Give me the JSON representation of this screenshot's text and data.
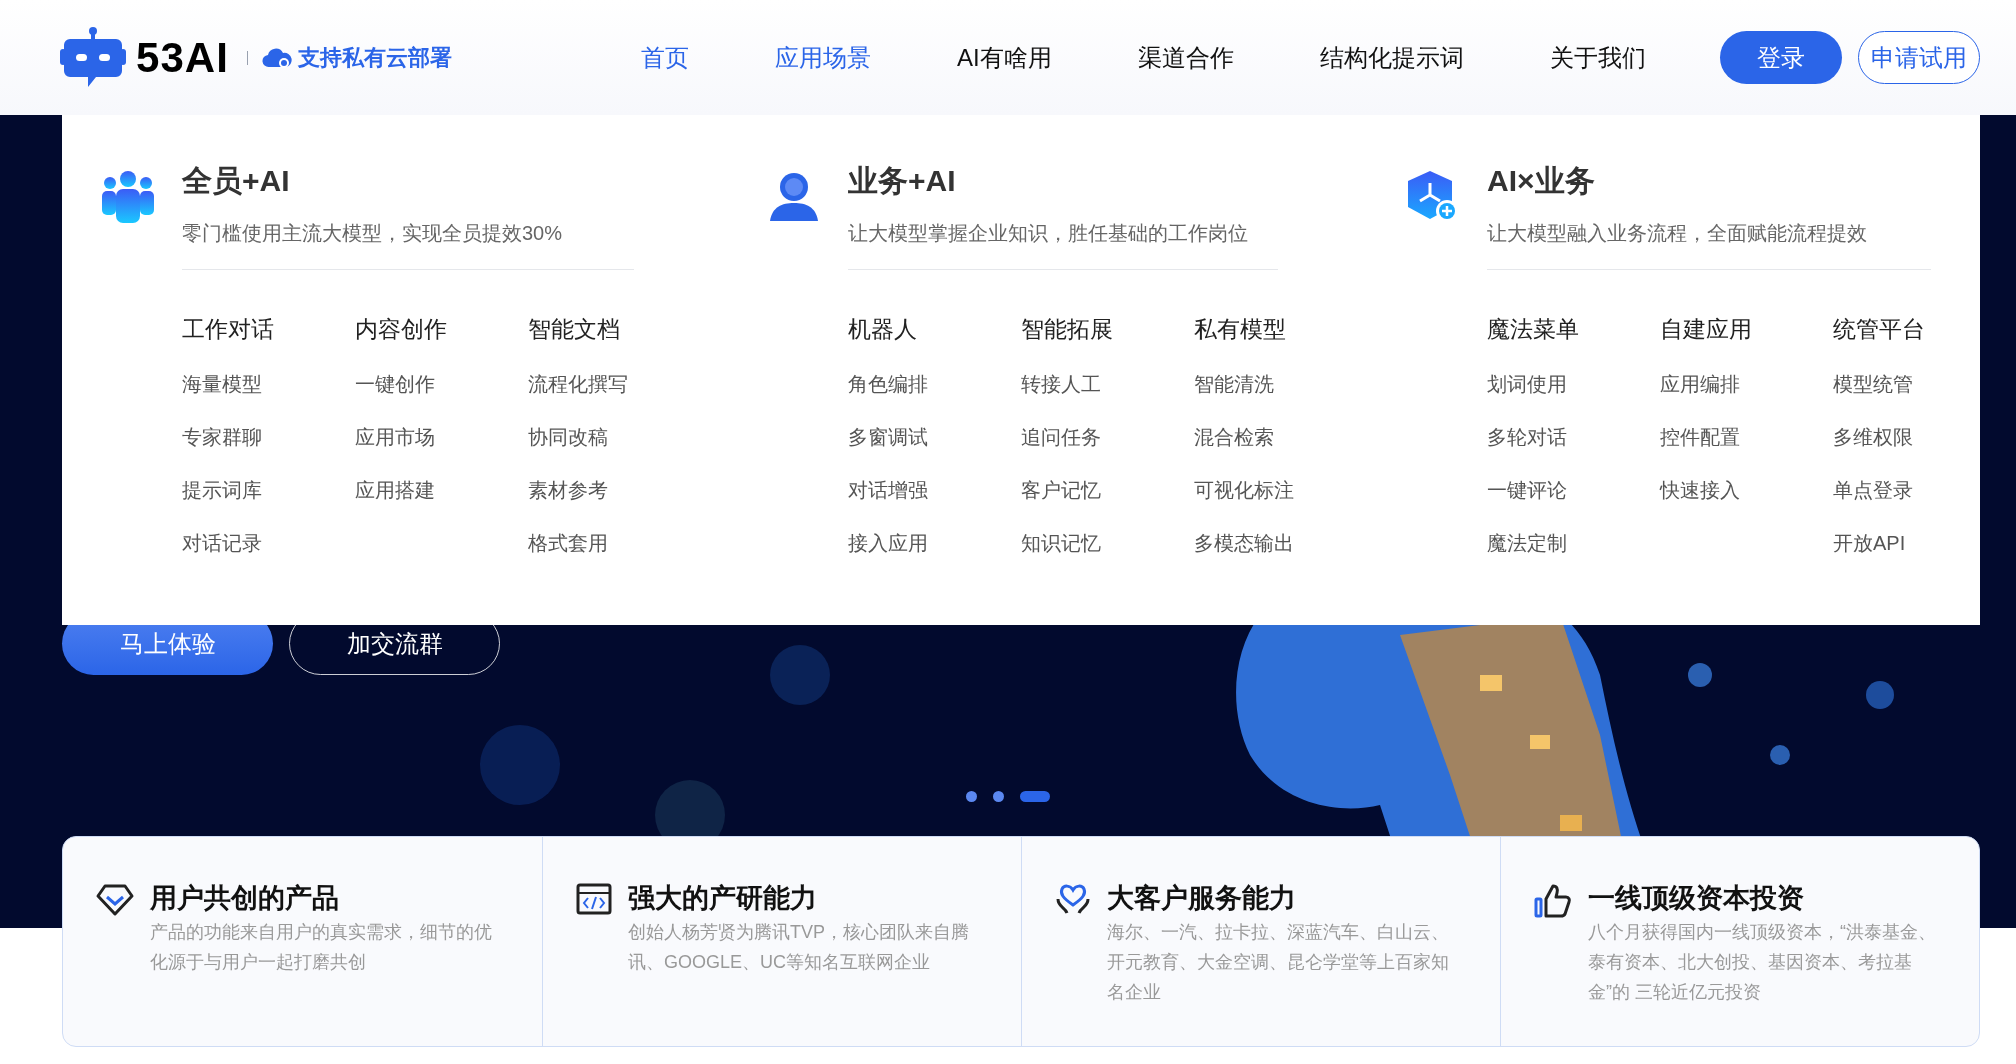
{
  "header": {
    "logo": "53AI",
    "tagline": "支持私有云部署",
    "nav": [
      {
        "label": "首页",
        "highlighted": true
      },
      {
        "label": "应用场景",
        "highlighted": true
      },
      {
        "label": "AI有啥用",
        "highlighted": false
      },
      {
        "label": "渠道合作",
        "highlighted": false
      },
      {
        "label": "结构化提示词",
        "highlighted": false
      },
      {
        "label": "关于我们",
        "highlighted": false
      }
    ],
    "login_button": "登录",
    "trial_button": "申请试用"
  },
  "menu": {
    "sections": [
      {
        "kind": "team",
        "title": "全员+AI",
        "subtitle": "零门槛使用主流大模型，实现全员提效30%",
        "columns": [
          {
            "heading": "工作对话",
            "items": [
              "海量模型",
              "专家群聊",
              "提示词库",
              "对话记录"
            ]
          },
          {
            "heading": "内容创作",
            "items": [
              "一键创作",
              "应用市场",
              "应用搭建"
            ]
          },
          {
            "heading": "智能文档",
            "items": [
              "流程化撰写",
              "协同改稿",
              "素材参考",
              "格式套用"
            ]
          }
        ]
      },
      {
        "kind": "person",
        "title": "业务+AI",
        "subtitle": "让大模型掌握企业知识，胜任基础的工作岗位",
        "columns": [
          {
            "heading": "机器人",
            "items": [
              "角色编排",
              "多窗调试",
              "对话增强",
              "接入应用"
            ]
          },
          {
            "heading": "智能拓展",
            "items": [
              "转接人工",
              "追问任务",
              "客户记忆",
              "知识记忆"
            ]
          },
          {
            "heading": "私有模型",
            "items": [
              "智能清洗",
              "混合检索",
              "可视化标注",
              "多模态输出"
            ]
          }
        ]
      },
      {
        "kind": "cube",
        "title": "AI×业务",
        "subtitle": "让大模型融入业务流程，全面赋能流程提效",
        "columns": [
          {
            "heading": "魔法菜单",
            "items": [
              "划词使用",
              "多轮对话",
              "一键评论",
              "魔法定制"
            ]
          },
          {
            "heading": "自建应用",
            "items": [
              "应用编排",
              "控件配置",
              "快速接入"
            ]
          },
          {
            "heading": "统管平台",
            "items": [
              "模型统管",
              "多维权限",
              "单点登录",
              "开放API"
            ]
          }
        ]
      }
    ]
  },
  "hero": {
    "buttons": [
      {
        "kind": "primary",
        "label": "马上体验"
      },
      {
        "kind": "outline",
        "label": "加交流群"
      }
    ],
    "slides": [
      {
        "selected": false
      },
      {
        "selected": false
      },
      {
        "selected": true
      }
    ]
  },
  "features": [
    {
      "kind": "diamond",
      "title": "用户共创的产品",
      "description": "产品的功能来自用户的真实需求，细节的优化源于与用户一起打磨共创"
    },
    {
      "kind": "code",
      "title": "强大的产研能力",
      "description": "创始人杨芳贤为腾讯TVP，核心团队来自腾讯、GOOGLE、UC等知名互联网企业"
    },
    {
      "kind": "heart",
      "title": "大客户服务能力",
      "description": "海尔、一汽、拉卡拉、深蓝汽车、白山云、开元教育、大金空调、昆仑学堂等上百家知名企业"
    },
    {
      "kind": "thumb",
      "title": "一线顶级资本投资",
      "description": "八个月获得国内一线顶级资本，“洪泰基金、泰有资本、北大创投、基因资本、考拉基金”的 三轮近亿元投资"
    }
  ]
}
